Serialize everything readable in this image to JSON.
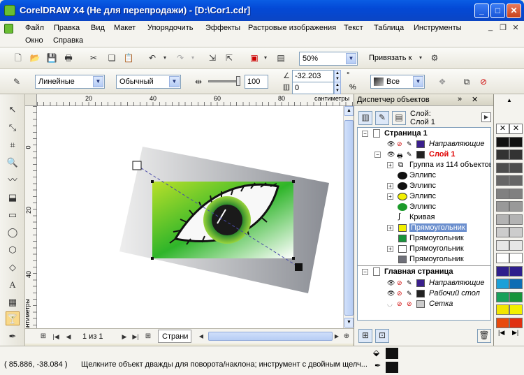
{
  "window": {
    "title": "CorelDRAW X4 (Не для перепродажи) - [D:\\Cor1.cdr]"
  },
  "menu": {
    "row1": [
      "Файл",
      "Правка",
      "Вид",
      "Макет",
      "Упорядочить",
      "Эффекты",
      "Растровые изображения",
      "Текст",
      "Таблица",
      "Инструменты"
    ],
    "row2": [
      "Окно",
      "Справка"
    ]
  },
  "toolbar": {
    "zoom": "50%",
    "snap_label": "Привязать к"
  },
  "propbar": {
    "line_style": "Линейные",
    "mode": "Обычный",
    "value": "100",
    "angle": "-32.203",
    "offset": "0",
    "pct1": "°",
    "pct2": "%",
    "scope": "Все"
  },
  "ruler": {
    "h_ticks": [
      "20",
      "40",
      "60",
      "80"
    ],
    "h_unit": "сантиметры",
    "v_ticks": [
      "0",
      "20",
      "40"
    ],
    "v_unit": "сантиметры"
  },
  "nav": {
    "page_count": "1 из 1",
    "page_tab": "Страни"
  },
  "docker": {
    "title": "Диспетчер объектов",
    "layer_label": "Слой:",
    "layer_name": "Слой 1",
    "rows": [
      {
        "label": "Страница 1"
      },
      {
        "label": "Направляющие"
      },
      {
        "label": "Слой 1"
      },
      {
        "label": "Группа из 114 объектов"
      },
      {
        "label": "Эллипс"
      },
      {
        "label": "Эллипс"
      },
      {
        "label": "Эллипс"
      },
      {
        "label": "Эллипс"
      },
      {
        "label": "Кривая"
      },
      {
        "label": "Прямоугольник"
      },
      {
        "label": "Прямоугольник"
      },
      {
        "label": "Прямоугольник"
      },
      {
        "label": "Прямоугольник"
      },
      {
        "label": "Главная страница"
      },
      {
        "label": "Направляющие"
      },
      {
        "label": "Рабочий стол"
      },
      {
        "label": "Сетка"
      }
    ]
  },
  "status": {
    "coords": "( 85.886, -38.084 )",
    "hint": "Щелкните объект дважды для поворота/наклона; инструмент с двойным щелч..."
  },
  "colors": {
    "title_blue": "#0a5de4",
    "selection": "#6b8fce"
  }
}
